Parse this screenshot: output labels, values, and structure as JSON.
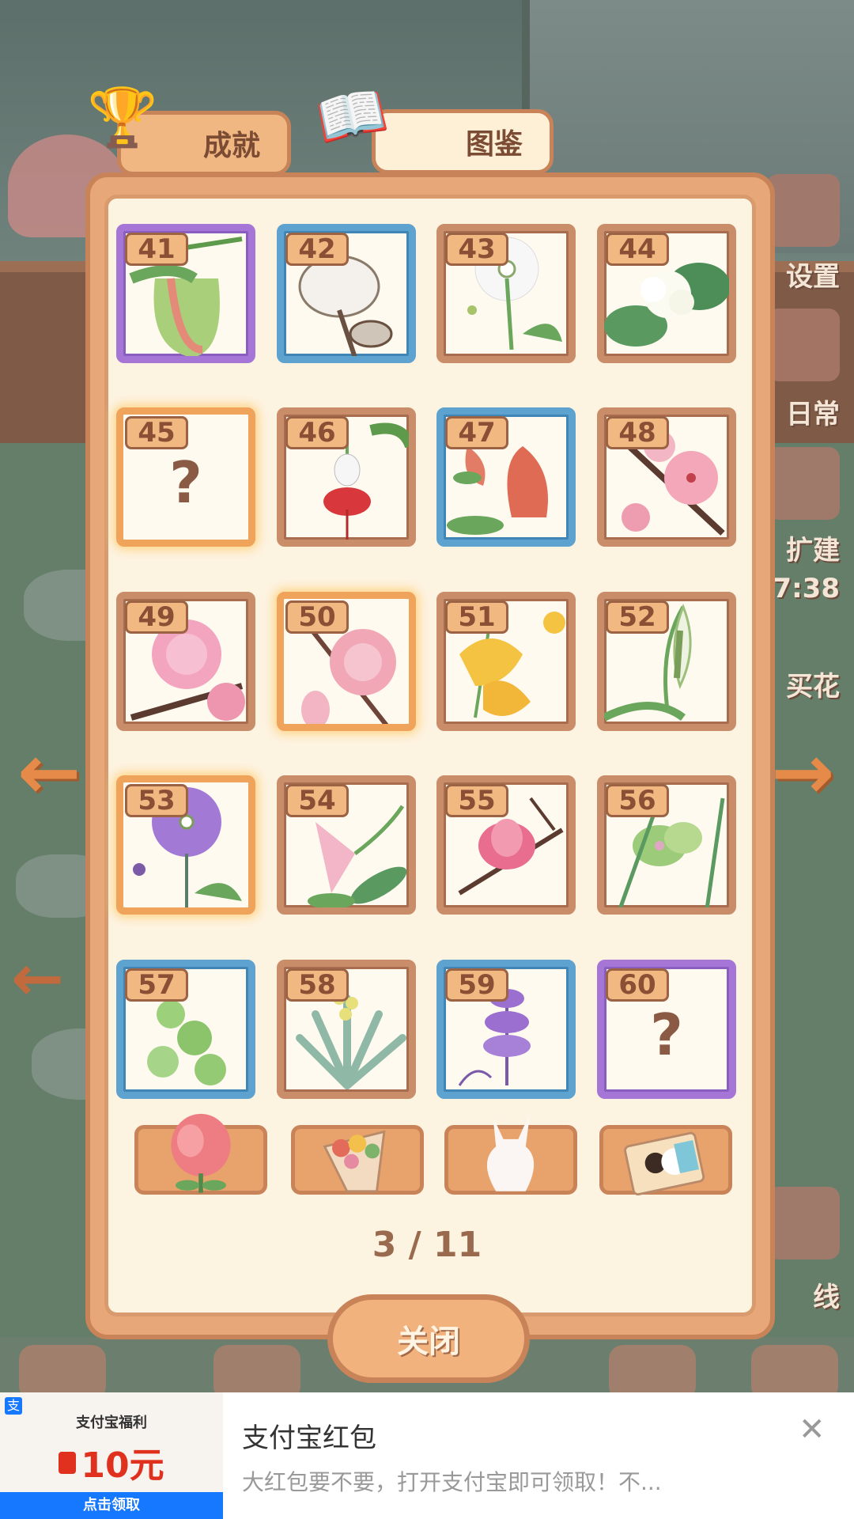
{
  "tabs": {
    "achievements": "成就",
    "guide": "图鉴"
  },
  "cards": [
    {
      "num": "41",
      "frame": "purple",
      "flower": "pitcher"
    },
    {
      "num": "42",
      "frame": "blue",
      "flower": "cotton"
    },
    {
      "num": "43",
      "frame": "brown",
      "flower": "dandelion"
    },
    {
      "num": "44",
      "frame": "brown",
      "flower": "gardenia"
    },
    {
      "num": "45",
      "frame": "orange",
      "flower": "unknown",
      "label": "?"
    },
    {
      "num": "46",
      "frame": "brown",
      "flower": "fuchsia"
    },
    {
      "num": "47",
      "frame": "blue",
      "flower": "bell-red"
    },
    {
      "num": "48",
      "frame": "brown",
      "flower": "peach"
    },
    {
      "num": "49",
      "frame": "brown",
      "flower": "pink-double"
    },
    {
      "num": "50",
      "frame": "orange",
      "flower": "pink-rose"
    },
    {
      "num": "51",
      "frame": "brown",
      "flower": "yellow-lily"
    },
    {
      "num": "52",
      "frame": "brown",
      "flower": "calla"
    },
    {
      "num": "53",
      "frame": "orange",
      "flower": "allium"
    },
    {
      "num": "54",
      "frame": "brown",
      "flower": "lily-pink"
    },
    {
      "num": "55",
      "frame": "brown",
      "flower": "magnolia"
    },
    {
      "num": "56",
      "frame": "brown",
      "flower": "orchid"
    },
    {
      "num": "57",
      "frame": "blue",
      "flower": "green-cluster"
    },
    {
      "num": "58",
      "frame": "brown",
      "flower": "spiky-green"
    },
    {
      "num": "59",
      "frame": "blue",
      "flower": "lavender"
    },
    {
      "num": "60",
      "frame": "purple",
      "flower": "unknown",
      "label": "?"
    }
  ],
  "categories": [
    "rose-flower-icon",
    "bouquet-icon",
    "vase-icon",
    "picture-icon"
  ],
  "pager": "3 / 11",
  "close_label": "关闭",
  "side_labels": [
    "设置",
    "日常",
    "扩建",
    "7:38",
    "买花",
    "线"
  ],
  "ad": {
    "brand": "支付宝福利",
    "amount": "10元",
    "cta": "点击领取",
    "title": "支付宝红包",
    "desc": "大红包要不要，打开支付宝即可领取！不...",
    "close": "✕"
  },
  "colors": {
    "accent": "#e8a779",
    "panel": "#fdf3e1",
    "ad_blue": "#1677ff",
    "ad_red": "#e0301e"
  }
}
